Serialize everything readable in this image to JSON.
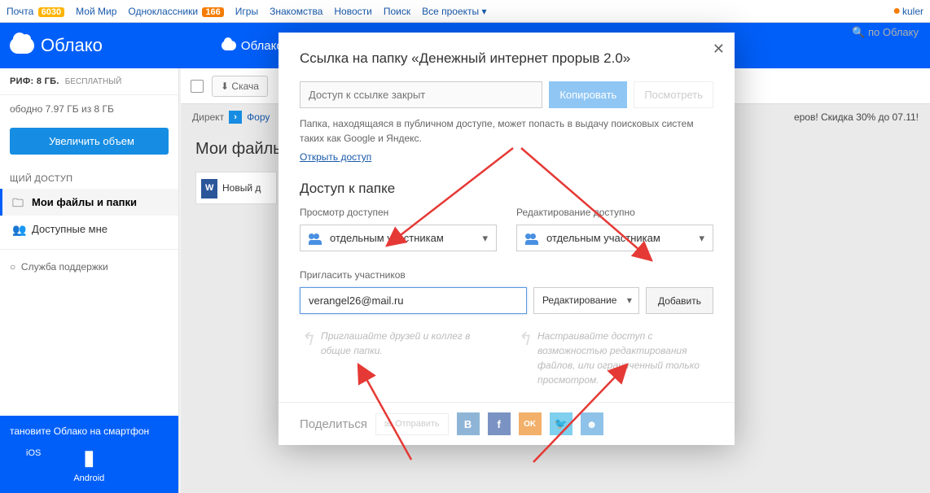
{
  "mailbar": {
    "items": [
      "Почта",
      "Мой Мир",
      "Одноклассники",
      "Игры",
      "Знакомства",
      "Новости",
      "Поиск",
      "Все проекты"
    ],
    "badge_mail": "6030",
    "badge_ok": "166",
    "dropdown_glyph": "▾",
    "user": "kuler"
  },
  "header": {
    "logo_text": "Облако",
    "cloud_tab": "Облако",
    "search_hint": "по Облаку"
  },
  "sidebar": {
    "tariff_label": "РИФ:",
    "tariff_value": "8 ГБ.",
    "tariff_plan": "БЕСПЛАТНЫЙ",
    "storage": "ободно 7.97 ГБ из 8 ГБ",
    "increase_btn": "Увеличить объем",
    "section_access": "ЩИЙ ДОСТУП",
    "nav_myfiles": "Мои файлы и папки",
    "nav_shared": "Доступные мне",
    "support": "Служба поддержки",
    "promo_title": "тановите Облако на смартфон",
    "ios_label": "iOS",
    "android_label": "Android"
  },
  "toolbar": {
    "download": "Скача"
  },
  "direct": {
    "label": "Директ",
    "arrow_glyph": "›",
    "forum": "Фору",
    "promo_tail": "еров! Скидка 30% до 07.11!"
  },
  "main": {
    "title": "Мои файль",
    "file_label": "Новый д"
  },
  "modal": {
    "close_glyph": "✕",
    "title": "Ссылка на папку «Денежный интернет прорыв 2.0»",
    "link_placeholder": "Доступ к ссылке закрыт",
    "copy_btn": "Копировать",
    "view_btn": "Посмотреть",
    "disclaimer": "Папка, находящаяся в публичном доступе, может попасть в выдачу поисковых систем таких как Google и Яндекс.",
    "open_access": "Открыть доступ",
    "access_title": "Доступ к папке",
    "view_label": "Просмотр доступен",
    "edit_label": "Редактирование доступно",
    "members_option": "отдельным участникам",
    "invite_label": "Пригласить участников",
    "invite_value": "verangel26@mail.ru",
    "perm_option": "Редактирование",
    "add_btn": "Добавить",
    "hint1": "Приглашайте друзей и коллег в общие папки.",
    "hint2": "Настраивайте доступ с возможностью редактирования файлов, или ограниченный только просмотром.",
    "share_label": "Поделиться",
    "send_label": "Отправить",
    "envelope_glyph": "✉",
    "social_vk": "В",
    "social_fb": "f",
    "social_ok": "OK",
    "social_mm": "☻"
  },
  "icons": {
    "apple": "",
    "android": "◧",
    "folder": "🗀",
    "people": "👥",
    "gear": "⚙",
    "curve": "↰",
    "support": "○",
    "download": "⬇",
    "twitter_bird": "🐦"
  }
}
